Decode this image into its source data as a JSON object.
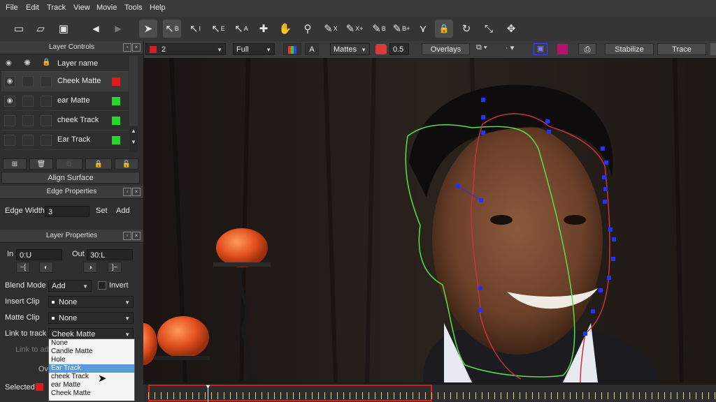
{
  "menubar": {
    "items": [
      "File",
      "Edit",
      "Track",
      "View",
      "Movie",
      "Tools",
      "Help"
    ]
  },
  "toolbar": {
    "tools": [
      {
        "icon": "new-document-icon",
        "glyph": "▭",
        "label": ""
      },
      {
        "icon": "open-folder-icon",
        "glyph": "▱",
        "label": ""
      },
      {
        "icon": "save-icon",
        "glyph": "▣",
        "label": ""
      },
      {
        "icon": "back-arrow-icon",
        "glyph": "◀",
        "label": ""
      },
      {
        "icon": "forward-arrow-icon",
        "glyph": "▶",
        "label": ""
      },
      {
        "icon": "select-pointer-icon",
        "glyph": "➤",
        "label": ""
      },
      {
        "icon": "select-b-icon",
        "glyph": "↖",
        "label": "B"
      },
      {
        "icon": "select-i-icon",
        "glyph": "↖",
        "label": "I"
      },
      {
        "icon": "select-e-icon",
        "glyph": "↖",
        "label": "E"
      },
      {
        "icon": "select-a-icon",
        "glyph": "↖",
        "label": "A"
      },
      {
        "icon": "add-point-icon",
        "glyph": "✚",
        "label": ""
      },
      {
        "icon": "hand-pan-icon",
        "glyph": "✋",
        "label": ""
      },
      {
        "icon": "zoom-icon",
        "glyph": "⚲",
        "label": ""
      },
      {
        "icon": "pen-x-icon",
        "glyph": "✎",
        "label": "X"
      },
      {
        "icon": "pen-x-plus-icon",
        "glyph": "✎",
        "label": "X+"
      },
      {
        "icon": "pen-b-icon",
        "glyph": "✎",
        "label": "B"
      },
      {
        "icon": "pen-b-plus-icon",
        "glyph": "✎",
        "label": "B+"
      },
      {
        "icon": "join-icon",
        "glyph": "⋎",
        "label": ""
      },
      {
        "icon": "lock-icon",
        "glyph": "🔒",
        "label": ""
      },
      {
        "icon": "rotate-icon",
        "glyph": "↻",
        "label": ""
      },
      {
        "icon": "scale-icon",
        "glyph": "⤡",
        "label": ""
      },
      {
        "icon": "move-icon",
        "glyph": "✥",
        "label": ""
      }
    ]
  },
  "toolbar2": {
    "layer_color": "#d21f1f",
    "layer_number": "2",
    "resolution": "Full",
    "channel": "A",
    "mattes": "Mattes",
    "opacity": "0.5",
    "overlays": "Overlays",
    "stabilize": "Stabilize",
    "trace": "Trace"
  },
  "layer_controls": {
    "title": "Layer Controls",
    "column_header": "Layer name",
    "layers": [
      {
        "name": "Cheek Matte",
        "color": "#e21a1a",
        "visible": true
      },
      {
        "name": "ear Matte",
        "color": "#27d62b",
        "visible": true
      },
      {
        "name": "cheek Track",
        "color": "#27d62b",
        "visible": false
      },
      {
        "name": "Ear Track",
        "color": "#27d62b",
        "visible": false
      }
    ],
    "align_surface": "Align Surface"
  },
  "edge_properties": {
    "title": "Edge Properties",
    "edge_width_label": "Edge Width",
    "edge_width_value": "3",
    "set": "Set",
    "add": "Add"
  },
  "layer_properties": {
    "title": "Layer Properties",
    "in_label": "In",
    "in_value": "0:U",
    "out_label": "Out",
    "out_value": "30:L",
    "blend_mode_label": "Blend Mode",
    "blend_mode_value": "Add",
    "invert": "Invert",
    "insert_clip_label": "Insert Clip",
    "insert_clip_value": "None",
    "matte_clip_label": "Matte Clip",
    "matte_clip_value": "None",
    "link_to_track_label": "Link to track",
    "link_to_track_value": "Cheek Matte",
    "link_to_label_faded": "Link to ad",
    "ov_label": "Ov",
    "selected_label": "Selected"
  },
  "dropdown": {
    "options": [
      "None",
      "Candle Matte",
      "Hole",
      "Ear Track",
      "cheek Track",
      "ear Matte",
      "Cheek Matte"
    ],
    "highlighted_index": 3
  },
  "colors": {
    "accent_red": "#d21f1f",
    "track_green": "#58e04c",
    "track_red": "#c8333f",
    "point_blue": "#2233ff"
  }
}
